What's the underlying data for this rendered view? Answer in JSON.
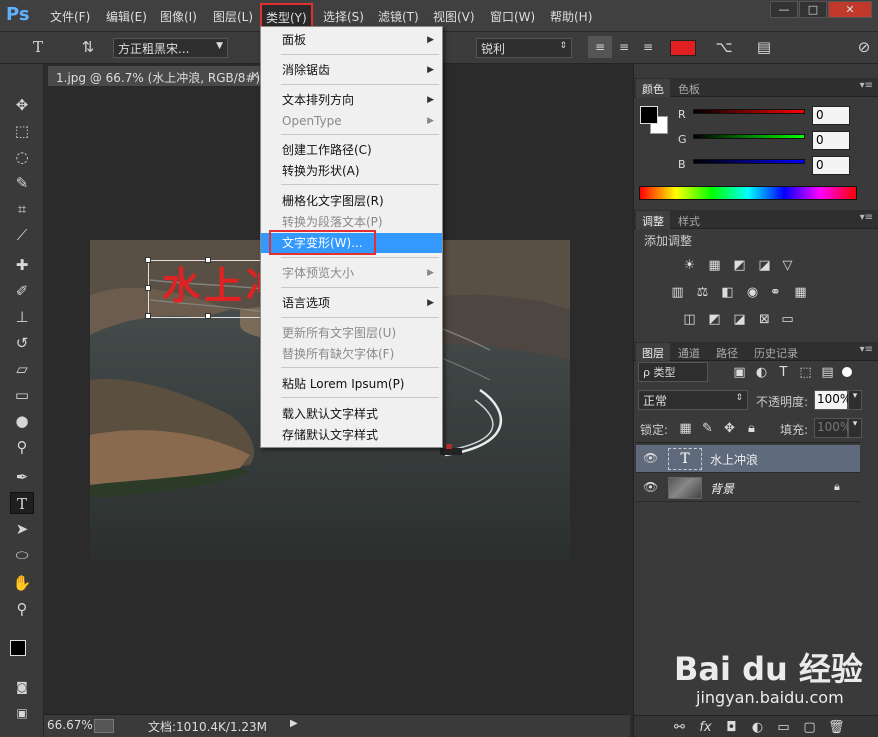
{
  "app": {
    "logo": "Ps"
  },
  "menubar": {
    "items": [
      "文件(F)",
      "编辑(E)",
      "图像(I)",
      "图层(L)",
      "类型(Y)",
      "选择(S)",
      "滤镜(T)",
      "视图(V)",
      "窗口(W)",
      "帮助(H)"
    ],
    "active_index": 4,
    "window_buttons": [
      "—",
      "□",
      "✕"
    ]
  },
  "options": {
    "font_family": "方正粗黑宋...",
    "antialias": "锐利",
    "text_color": "#e02020"
  },
  "document": {
    "tab_title": "1.jpg @ 66.7% (水上冲浪, RGB/8#) *",
    "close": "×",
    "layer_text": "水上冲浪"
  },
  "type_menu": {
    "items": [
      {
        "label": "面板",
        "submenu": true,
        "disabled": false
      },
      {
        "label": "消除锯齿",
        "submenu": true,
        "disabled": false
      },
      {
        "label": "文本排列方向",
        "submenu": true,
        "disabled": false
      },
      {
        "label": "OpenType",
        "submenu": true,
        "disabled": true
      },
      {
        "label": "创建工作路径(C)",
        "submenu": false,
        "disabled": false
      },
      {
        "label": "转换为形状(A)",
        "submenu": false,
        "disabled": false
      },
      {
        "label": "栅格化文字图层(R)",
        "submenu": false,
        "disabled": false
      },
      {
        "label": "转换为段落文本(P)",
        "submenu": false,
        "disabled": true
      },
      {
        "label": "文字变形(W)...",
        "submenu": false,
        "disabled": false,
        "highlighted": true
      },
      {
        "label": "字体预览大小",
        "submenu": true,
        "disabled": true
      },
      {
        "label": "语言选项",
        "submenu": true,
        "disabled": false
      },
      {
        "label": "更新所有文字图层(U)",
        "submenu": false,
        "disabled": true
      },
      {
        "label": "替换所有缺欠字体(F)",
        "submenu": false,
        "disabled": true
      },
      {
        "label": "粘贴 Lorem Ipsum(P)",
        "submenu": false,
        "disabled": false
      },
      {
        "label": "载入默认文字样式",
        "submenu": false,
        "disabled": false
      },
      {
        "label": "存储默认文字样式",
        "submenu": false,
        "disabled": false
      }
    ]
  },
  "status": {
    "zoom": "66.67%",
    "doc_info": "文档:1010.4K/1.23M"
  },
  "color_panel": {
    "tabs": [
      "颜色",
      "色板"
    ],
    "channels": [
      {
        "label": "R",
        "value": "0"
      },
      {
        "label": "G",
        "value": "0"
      },
      {
        "label": "B",
        "value": "0"
      }
    ]
  },
  "adjust_panel": {
    "tabs": [
      "调整",
      "样式"
    ],
    "heading": "添加调整"
  },
  "layers_panel": {
    "tabs": [
      "图层",
      "通道",
      "路径",
      "历史记录"
    ],
    "filter_label": "ρ 类型",
    "blend_mode": "正常",
    "opacity_label": "不透明度:",
    "opacity_value": "100%",
    "lock_label": "锁定:",
    "fill_label": "填充:",
    "fill_value": "100%",
    "layers": [
      {
        "name": "水上冲浪",
        "type": "text",
        "selected": true
      },
      {
        "name": "背景",
        "type": "image",
        "selected": false,
        "locked": true
      }
    ]
  },
  "watermark": {
    "logo": "Bai du 经验",
    "url": "jingyan.baidu.com"
  }
}
